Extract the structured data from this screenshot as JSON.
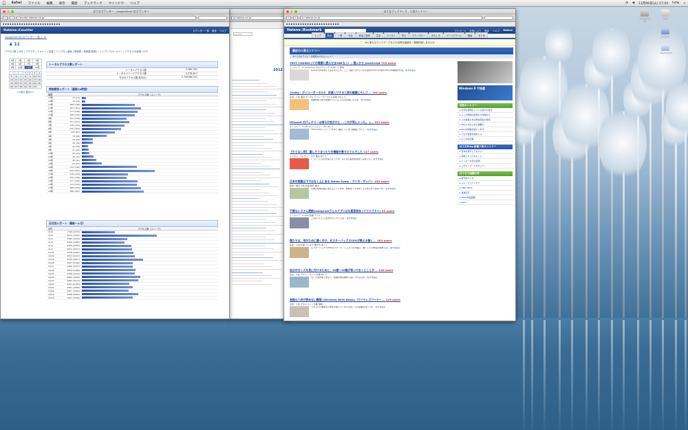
{
  "menubar": {
    "apple": "",
    "items": [
      "Safari",
      "ファイル",
      "編集",
      "表示",
      "履歴",
      "ブックマーク",
      "ウインドウ",
      "ヘルプ"
    ],
    "clock": "11月06日(火) 17:04",
    "user": "hsfw"
  },
  "colors": {
    "hatena_blue": "#2350a0",
    "bar_blue": "#2952a3",
    "users_red": "#e0201b",
    "side_green": "#56a02e"
  },
  "counter_window": {
    "title": "はてなカウンター - sangenkkmt のカウンター",
    "url": "counter.hatena.ne.jp",
    "header_logo": "Hatena::Counter",
    "header_links": [
      "カウンター一覧",
      "設定",
      "ヘルプ"
    ],
    "breadcrumb": "sangenkkmtのカウンター一覧 > 11",
    "page_title": "11",
    "nav_links": "アクセス数 | URL | ブラウザ | ドメイン | 言語 | リンク元 | 画面 | 検索語 | 検索語(英単) | トップレベルドメイン | アクセス元地域 | ログ",
    "calendar": {
      "rows": [
        [
          "1月",
          "2月",
          "3月",
          "4月"
        ],
        [
          "5月",
          "6月",
          "7月",
          "8月"
        ],
        [
          "9月",
          "10月",
          "11月",
          "12月"
        ]
      ],
      "days": [
        [
          "",
          "",
          "",
          "1",
          "2",
          "3",
          "4"
        ],
        [
          "5",
          "6",
          "7",
          "8",
          "9",
          "10",
          "11"
        ],
        [
          "12",
          "13",
          "14",
          "15",
          "16",
          "17",
          "18"
        ],
        [
          "19",
          "20",
          "21",
          "22",
          "23",
          "24",
          "25"
        ],
        [
          "26",
          "27",
          "28",
          "29",
          "30",
          "31",
          ""
        ]
      ],
      "selected_month": "11月",
      "footer": "<<前日 翌日>>"
    },
    "total_section": {
      "heading": "トータルアクセス数レポート",
      "rows": [
        {
          "k": "トータルアクセス数",
          "v": "2,780,701"
        },
        {
          "k": "トータルユニークアクセス数",
          "v": "2,278,817"
        },
        {
          "k": "今日のアクセス数(前日比)",
          "v": "1,749(98.0%)"
        }
      ]
    },
    "hourly_section": {
      "heading": "時間帯別レポート（最新24時間）",
      "col_time": "時間",
      "col_count": "",
      "col_bar": "アクセス数（ユニーク）",
      "rows": [
        {
          "d": "15時",
          "n": "13 (13)",
          "v": 13
        },
        {
          "d": "14時",
          "n": "10 (10)",
          "v": 10
        },
        {
          "d": "13時",
          "n": "168 (148)",
          "v": 168
        },
        {
          "d": "12時",
          "n": "187 (164)",
          "v": 187
        },
        {
          "d": "11時",
          "n": "177 (146)",
          "v": 177
        },
        {
          "d": "10時",
          "n": "168 (140)",
          "v": 168
        },
        {
          "d": "9時",
          "n": "141 (118)",
          "v": 141
        },
        {
          "d": "8時",
          "n": "151 (127)",
          "v": 151
        },
        {
          "d": "7時",
          "n": "136 (110)",
          "v": 136
        },
        {
          "d": "6時",
          "n": "125 (104)",
          "v": 125
        },
        {
          "d": "5時",
          "n": "105 (87)",
          "v": 105
        },
        {
          "d": "4時",
          "n": "79 (68)",
          "v": 79
        },
        {
          "d": "3時",
          "n": "34 (28)",
          "v": 34
        },
        {
          "d": "2時",
          "n": "35 (30)",
          "v": 35
        },
        {
          "d": "1時",
          "n": "20 (18)",
          "v": 20
        },
        {
          "d": "0時",
          "n": "21 (20)",
          "v": 21
        },
        {
          "d": "23時",
          "n": "25 (24)",
          "v": 25
        },
        {
          "d": "22時",
          "n": "36 (33)",
          "v": 36
        },
        {
          "d": "21時",
          "n": "46 (41)",
          "v": 46
        },
        {
          "d": "20時",
          "n": "64 (57)",
          "v": 64
        },
        {
          "d": "19時",
          "n": "174 (146)",
          "v": 174
        },
        {
          "d": "18時",
          "n": "232 (197)",
          "v": 232
        },
        {
          "d": "17時",
          "n": "146 (123)",
          "v": 146
        },
        {
          "d": "16時",
          "n": "142 (118)",
          "v": 142
        },
        {
          "d": "15時",
          "n": "177 (149)",
          "v": 177
        },
        {
          "d": "14時",
          "n": "174 (150)",
          "v": 174
        },
        {
          "d": "13時",
          "n": "188 (158)",
          "v": 188
        },
        {
          "d": "12時",
          "n": "196 (167)",
          "v": 196
        }
      ]
    },
    "daily_section": {
      "heading": "日付別レポート（最新一ヶ月）",
      "col_date": "日付",
      "col_bar": "アクセス数（ユニーク）",
      "rows": [
        {
          "d": "11/6",
          "n": "1749 (1474)",
          "v": 1749
        },
        {
          "d": "11/5",
          "n": "3972 (3432)",
          "v": 3972
        },
        {
          "d": "11/4",
          "n": "2385 (2054)",
          "v": 2385
        },
        {
          "d": "11/3",
          "n": "2269 (1965)",
          "v": 2269
        },
        {
          "d": "11/2",
          "n": "2620 (2287)",
          "v": 2620
        },
        {
          "d": "11/1",
          "n": "2672 (2317)",
          "v": 2672
        },
        {
          "d": "10/31",
          "n": "2728 (2361)",
          "v": 2728
        },
        {
          "d": "10/30",
          "n": "2813 (2427)",
          "v": 2813
        },
        {
          "d": "10/29",
          "n": "3226 (2817)",
          "v": 3226
        },
        {
          "d": "10/28",
          "n": "2697 (2340)",
          "v": 2697
        },
        {
          "d": "10/27",
          "n": "2685 (2307)",
          "v": 2685
        },
        {
          "d": "10/26",
          "n": "2854 (2489)",
          "v": 2854
        },
        {
          "d": "10/25",
          "n": "2788 (2415)",
          "v": 2788
        },
        {
          "d": "10/24",
          "n": "3082 (2665)",
          "v": 3082
        },
        {
          "d": "10/23",
          "n": "2965 (2572)",
          "v": 2965
        },
        {
          "d": "10/22",
          "n": "2491 (2160)",
          "v": 2491
        },
        {
          "d": "10/21",
          "n": "2681 (1680)",
          "v": 2681
        },
        {
          "d": "10/20",
          "n": "2467 (1964)",
          "v": 2467
        },
        {
          "d": "10/19",
          "n": "2998 (2605)",
          "v": 2998
        },
        {
          "d": "10/18",
          "n": "2697 (2340)",
          "v": 2697
        }
      ]
    }
  },
  "mid_window": {
    "url": "b.hatena.ne.jp",
    "search_placeholder": "Google",
    "date_label": "2012"
  },
  "bookmark_window": {
    "title": "はてなブックマーク - 人気エントリー",
    "url": "b.hatena.ne.jp",
    "logo": "Hatena::Bookmark",
    "header_links": [
      "マイページ",
      "お気に入り",
      "設定",
      "ヘルプ"
    ],
    "header_right": "Hatena",
    "tabs": [
      "トップ",
      "総合",
      "一般",
      "社会",
      "政治と経済",
      "生活",
      "エンタメ",
      "学び",
      "テクノロジー",
      "おもしろ",
      "アニメとゲーム",
      "動画",
      "まとめ"
    ],
    "active_tab": 1,
    "notice": "Yen 新たなブックマークなどの活発な議論を一度御利用しませんか",
    "breadcrumb": "はてなブックマーク > 人気エントリー",
    "section_title": "最近の人気エントリー",
    "section_sub": "すべてのカテゴリーの話題の人気エントリー",
    "entries": [
      {
        "title": "TEST CODINGっての需要に読んだまSBKなっ！ / 僕入から JavaScript",
        "users": "703 users",
        "meta": "エンジニア・IT javascript プログラミング JS あとで 参考",
        "text": "JavaScriptを学んでみるならこれ。ここで紹介されているのはTest DrivenなJavaScript開発の方法。",
        "more": "続きを読む"
      },
      {
        "title": "@nifty：デイリーポータルZ：卒業入りすると家の概要にもして...",
        "users": "196 users",
        "meta": "生活・人生 面白 ポータル デイリーポータルZ 記事 おもしろ",
        "text": "周囲を知る家の家族がいらっしゃるのは楽しいです。",
        "more": "続きを読む"
      },
      {
        "title": "iPhone5 のパッテリーは持ちが良ぎかに ...このが気に入った。 [...",
        "users": "221 users",
        "meta": "エンジニア・IT iphone バッテリー iOS あとで",
        "text": "iPhone5のバッテリーが早く消耗してしまう理由について…",
        "more": "続きを読む"
      },
      {
        "title": "【ちてなし特】 嬉しそうまったりの機能を数々たてんでした",
        "users": "227 users",
        "meta": "エンタメ・カルチャー ネタ 面白 あとで",
        "text": "とうとうこの日が来たようです。気になる話題を集めてみました。",
        "more": "続きを読む"
      },
      {
        "title": "日本の問題は下ではなく上にある Meme Same - マイネ・ザッバー",
        "users": "154 users",
        "meta": "政治・経済 日本 社会 教育 経済",
        "text": "日本の社会全般に言えることですが、問題は下ではなく上にあるのではないか。",
        "more": "続きを読む"
      },
      {
        "title": "不要なシステム更新Instagramウェルアプリはも案答依存 (ドファブライ)",
        "users": "93 users",
        "meta": "エンジニア・IT web 技術 アプリ",
        "text": "このようにして生まれたシステムは…",
        "more": "続きを読む"
      },
      {
        "title": "僕たちは、何のために働くのか、元スターバックスCEOが教える働く...",
        "users": "163 users",
        "meta": "生活・人生 仕事 ビジネス 働き方 あとで",
        "text": "元スターバックスCEOのハワード・シュルツ氏が語る、働くことの本当の意味とは。",
        "more": "続きを読む"
      },
      {
        "title": "自分のセンスを身に付けるために、10歳〜20歳が知っておくとことか...",
        "users": "118 users",
        "meta": "生活・人生 デザイン センス 仕事 あとで",
        "text": "センスは才能ではなく、知識の積み重ねで身につけるもの…",
        "more": "続きを読む"
      },
      {
        "title": "有能な人材が辞めない職場 (Wireless Wire News)（ワイヤレスワイヤー...",
        "users": "149 users",
        "meta": "生活・人生 マネジメント 仕事 組織",
        "text": "できるだけ優秀な人材を手放したくないのは、どの企業も同じです。",
        "more": "続きを読む"
      }
    ],
    "side_sections": [
      {
        "head": "注目エントリー",
        "items": [
          "大切な質問をしている最大の世代",
          "ここが問題の起源を今年度中で…",
          "この投稿さまは現在有名な情報…",
          "中の人がはじめる連載の…",
          "Macの勉強を紹介します…",
          "ブログ運営を始めたら…",
          "どこかの記事…"
        ]
      },
      {
        "head": "はてなBlog 新着人気エントリー",
        "items": [
          "日本を旅行してみたい…",
          "週末にやってみたこと…",
          "ハッピーな日の記録…",
          "このキーボードがすごい…"
        ]
      },
      {
        "head": "はてなで話題の本",
        "items": [
          "新刊のマンガ",
          "ジャンプコミックス",
          "ONE PIECE",
          "鬼滅の刃",
          "LEGO作品図鑑",
          "Jeem"
        ]
      }
    ],
    "ad_text": "Windows 8 で快適"
  },
  "desktop_icons": [
    "Macintosh HD",
    "hsfw",
    "Dropbox",
    "Documents"
  ]
}
